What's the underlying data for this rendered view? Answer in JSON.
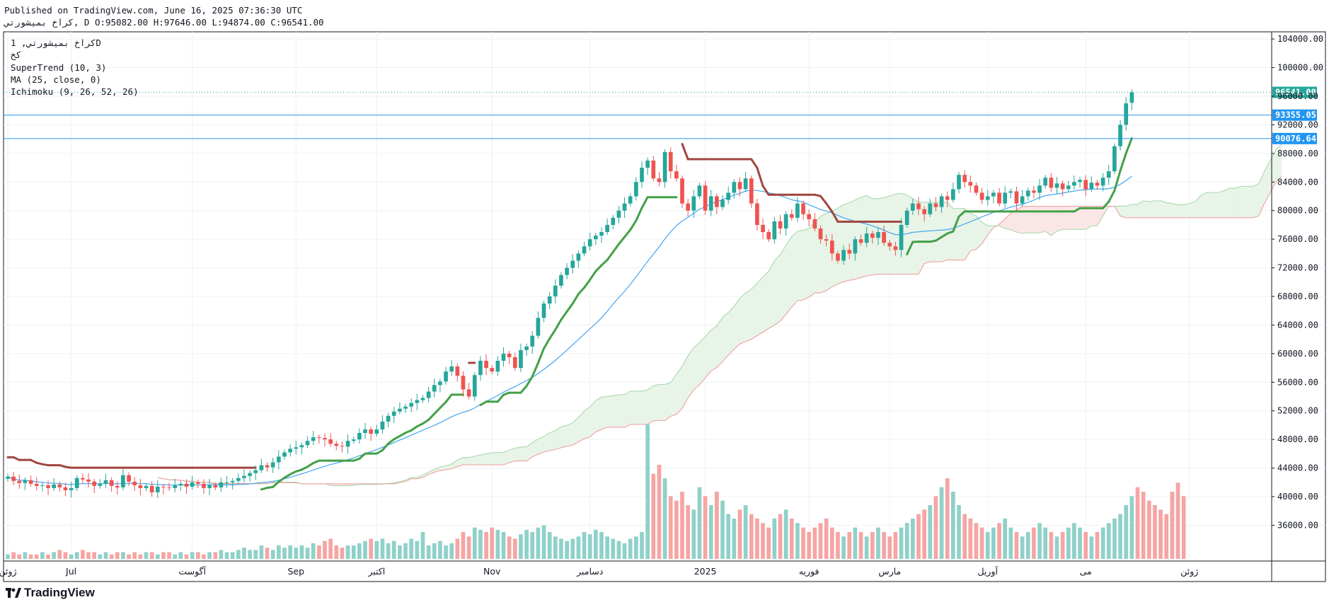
{
  "header": {
    "published_line": "Published on TradingView.com, June 16, 2025 07:36:30 UTC",
    "symbol_line": "كراخ بميشورتي, D O:95082.00 H:97646.00 L:94874.00 C:96541.00"
  },
  "legend": {
    "symbol": "كراخ بميشورتي, 1D",
    "exchange": "كخ",
    "supertrend": "SuperTrend (10, 3)",
    "ma": "MA (25, close, 0)",
    "ichimoku": "Ichimoku (9, 26, 52, 26)"
  },
  "brand": {
    "name": "TradingView"
  },
  "colors": {
    "up": "#26a69a",
    "down": "#ef5350",
    "vol_up": "#8fd1c9",
    "vol_down": "#f5a5a3",
    "supertrend_up": "#43a047",
    "supertrend_down": "#a0463f",
    "ma": "#42a5f5",
    "cloud_bull": "#e7f4e7",
    "cloud_bear": "#fbe6e6",
    "level_line": "#2196f3",
    "price_label": "#26a69a"
  },
  "chart_data": {
    "type": "candlestick",
    "y_ticks": [
      "104000.00",
      "100000.00",
      "96000.00",
      "92000.00",
      "88000.00",
      "84000.00",
      "80000.00",
      "76000.00",
      "72000.00",
      "68000.00",
      "64000.00",
      "60000.00",
      "56000.00",
      "52000.00",
      "48000.00",
      "44000.00",
      "40000.00",
      "36000.00"
    ],
    "ylim": [
      31000,
      105000
    ],
    "last_price": "96541.00",
    "levels": [
      "93355.05",
      "90076.64"
    ],
    "x_labels": [
      {
        "t": "ژوئن",
        "i": 0
      },
      {
        "t": "Jul",
        "i": 11
      },
      {
        "t": "آگوست",
        "i": 32
      },
      {
        "t": "Sep",
        "i": 50
      },
      {
        "t": "اکتبر",
        "i": 64
      },
      {
        "t": "Nov",
        "i": 84
      },
      {
        "t": "دسامبر",
        "i": 101
      },
      {
        "t": "2025",
        "i": 121
      },
      {
        "t": "فوریه",
        "i": 139
      },
      {
        "t": "مارس",
        "i": 153
      },
      {
        "t": "آوریل",
        "i": 170
      },
      {
        "t": "می",
        "i": 187
      },
      {
        "t": "ژوئن",
        "i": 205
      }
    ],
    "n_slots": 220,
    "closes": [
      42800,
      42200,
      41900,
      42300,
      41800,
      41500,
      41600,
      41200,
      41700,
      41300,
      40900,
      41200,
      42600,
      42400,
      42100,
      41500,
      41800,
      42300,
      41500,
      41300,
      43000,
      42100,
      41600,
      41200,
      41500,
      40600,
      41400,
      41300,
      41200,
      41600,
      41800,
      41400,
      42000,
      41800,
      41200,
      41600,
      41300,
      42000,
      42000,
      42200,
      42600,
      42900,
      43300,
      43700,
      44400,
      44100,
      44800,
      45600,
      46200,
      46700,
      46900,
      47200,
      47800,
      48300,
      48200,
      48000,
      47400,
      47100,
      47000,
      47800,
      48000,
      48900,
      49400,
      48800,
      49400,
      50500,
      51300,
      51900,
      52300,
      52600,
      53100,
      53500,
      53800,
      54700,
      55600,
      56100,
      57500,
      58200,
      56900,
      55000,
      54000,
      57000,
      59000,
      58000,
      57500,
      59000,
      60000,
      59500,
      58000,
      60500,
      61000,
      62500,
      65000,
      67000,
      68000,
      69500,
      71000,
      72000,
      73000,
      74000,
      75000,
      76000,
      76500,
      77000,
      78000,
      79000,
      80000,
      81000,
      82000,
      84000,
      86000,
      87000,
      84500,
      84000,
      88200,
      85500,
      84500,
      81000,
      80000,
      82000,
      83500,
      80000,
      82000,
      80500,
      81500,
      82500,
      84000,
      83000,
      84500,
      81000,
      78000,
      77000,
      76000,
      78500,
      77500,
      79500,
      79000,
      81000,
      79500,
      78800,
      77500,
      76000,
      75800,
      74000,
      73000,
      74500,
      74000,
      76000,
      75500,
      76800,
      76200,
      77000,
      75500,
      75000,
      74500,
      78000,
      80000,
      81000,
      80200,
      79500,
      81000,
      80500,
      82000,
      81500,
      83000,
      85000,
      84000,
      83500,
      82500,
      81500,
      82000,
      82500,
      81000,
      82500,
      82700,
      81000,
      82000,
      82800,
      82500,
      83500,
      84600,
      83200,
      83800,
      83000,
      83500,
      84000,
      84300,
      83000,
      83900,
      83500,
      84600,
      85500,
      89000,
      92000,
      95000,
      96541
    ],
    "opens": [
      42500,
      42800,
      42200,
      41900,
      42300,
      41800,
      41500,
      41600,
      41200,
      41700,
      41300,
      40900,
      41200,
      42600,
      42400,
      42100,
      41500,
      41800,
      42300,
      41500,
      41300,
      43000,
      42100,
      41600,
      41200,
      41500,
      40600,
      41400,
      41300,
      41200,
      41600,
      41800,
      41400,
      42000,
      41800,
      41200,
      41600,
      41300,
      42000,
      42000,
      42200,
      42600,
      42900,
      43300,
      43700,
      44400,
      44100,
      44800,
      45600,
      46200,
      46700,
      46900,
      47200,
      47800,
      48300,
      48200,
      48000,
      47400,
      47100,
      47000,
      47800,
      48000,
      48900,
      49400,
      48800,
      49400,
      50500,
      51300,
      51900,
      52300,
      52600,
      53100,
      53500,
      53800,
      54700,
      55600,
      56100,
      57500,
      58200,
      56900,
      55000,
      54000,
      57000,
      59000,
      58000,
      57500,
      59000,
      60000,
      59500,
      58000,
      60500,
      61000,
      62500,
      65000,
      67000,
      68000,
      69500,
      71000,
      72000,
      73000,
      74000,
      75000,
      76000,
      76500,
      77000,
      78000,
      79000,
      80000,
      81000,
      82000,
      84000,
      86000,
      87000,
      84500,
      84000,
      88200,
      85500,
      84500,
      81000,
      80000,
      82000,
      83500,
      80000,
      82000,
      80500,
      81500,
      82500,
      84000,
      83000,
      84500,
      81000,
      78000,
      77000,
      76000,
      78500,
      77500,
      79500,
      79000,
      81000,
      79500,
      78800,
      77500,
      76000,
      75800,
      74000,
      73000,
      74500,
      74000,
      76000,
      75500,
      76800,
      76200,
      77000,
      75500,
      75000,
      74500,
      78000,
      80000,
      81000,
      80200,
      79500,
      81000,
      80500,
      82000,
      81500,
      83000,
      85000,
      84000,
      83500,
      82500,
      81500,
      82000,
      82500,
      81000,
      82500,
      82700,
      81000,
      82000,
      82800,
      82500,
      83500,
      84600,
      83200,
      83800,
      83000,
      83500,
      84000,
      84300,
      83000,
      83900,
      83500,
      84600,
      85500,
      89000,
      92000,
      95082
    ],
    "volumes": [
      2,
      3,
      2,
      3,
      2,
      2,
      3,
      2,
      3,
      4,
      3,
      2,
      3,
      4,
      3,
      3,
      2,
      3,
      2,
      3,
      3,
      2,
      3,
      2,
      3,
      3,
      2,
      3,
      3,
      2,
      3,
      2,
      3,
      3,
      2,
      3,
      3,
      4,
      3,
      3,
      4,
      5,
      4,
      4,
      6,
      5,
      4,
      6,
      5,
      6,
      5,
      6,
      5,
      7,
      6,
      8,
      9,
      6,
      5,
      6,
      6,
      7,
      8,
      9,
      8,
      9,
      7,
      8,
      6,
      7,
      9,
      8,
      12,
      6,
      7,
      8,
      6,
      7,
      9,
      12,
      10,
      14,
      13,
      12,
      14,
      13,
      12,
      10,
      9,
      11,
      13,
      12,
      14,
      15,
      12,
      10,
      9,
      8,
      9,
      10,
      12,
      11,
      13,
      12,
      10,
      9,
      8,
      7,
      9,
      10,
      12,
      60,
      38,
      42,
      36,
      28,
      26,
      30,
      24,
      22,
      32,
      28,
      24,
      30,
      26,
      20,
      18,
      22,
      24,
      20,
      18,
      16,
      14,
      18,
      20,
      22,
      18,
      16,
      14,
      12,
      14,
      16,
      18,
      14,
      12,
      10,
      12,
      14,
      12,
      10,
      12,
      14,
      12,
      10,
      12,
      14,
      16,
      18,
      20,
      22,
      24,
      28,
      32,
      36,
      30,
      24,
      20,
      18,
      16,
      14,
      12,
      14,
      16,
      18,
      14,
      12,
      10,
      12,
      14,
      16,
      14,
      12,
      10,
      12,
      14,
      16,
      14,
      12,
      10,
      12,
      14,
      16,
      18,
      20,
      24,
      28,
      32,
      30,
      26,
      24,
      22,
      20,
      30,
      34,
      28
    ],
    "supertrend": [
      {
        "from": 0,
        "to": 16,
        "side": "down",
        "v": [
          44000,
          44000,
          44000,
          44000,
          43600,
          42900,
          42900,
          42900,
          42600,
          42600,
          42600,
          42600,
          42600,
          42600,
          42600,
          42600,
          42600
        ]
      },
      {
        "from": 16,
        "to": 121,
        "side": "up",
        "v": null
      },
      {
        "from": 129,
        "to": 169,
        "side": "down",
        "v": null
      }
    ],
    "ma_start": 0,
    "cloud_note": "Ichimoku cloud leading span"
  }
}
